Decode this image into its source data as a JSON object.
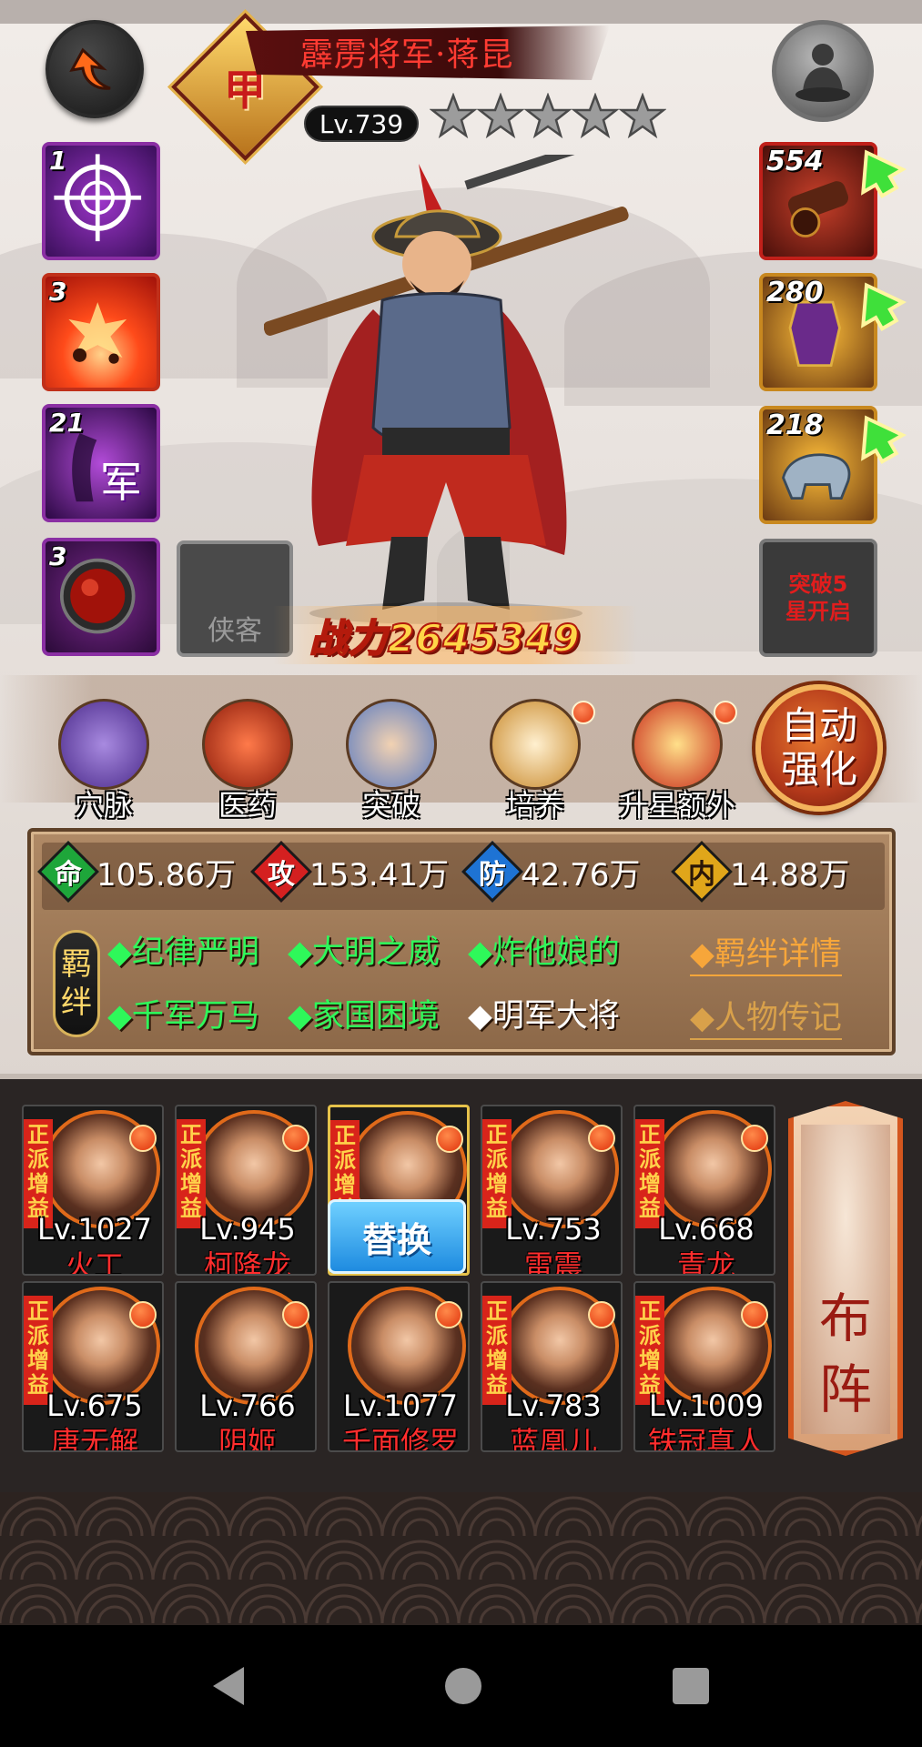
{
  "hero": {
    "name": "霹雳将军·蒋昆",
    "level": "Lv.739",
    "rank_char": "甲",
    "stars": 5,
    "power": "战力2645349"
  },
  "skills": [
    {
      "count": "1",
      "icon": "crosshair-icon"
    },
    {
      "count": "3",
      "icon": "explosion-icon"
    },
    {
      "count": "21",
      "icon": "army-icon",
      "label": "军"
    },
    {
      "count": "3",
      "icon": "red-orb-icon"
    }
  ],
  "companion_slot": {
    "label": "侠客"
  },
  "equipment": [
    {
      "count": "554",
      "icon": "cannon-icon"
    },
    {
      "count": "280",
      "icon": "urn-icon"
    },
    {
      "count": "218",
      "icon": "tiger-icon"
    }
  ],
  "breakthrough_slot": {
    "line1": "突破5",
    "line2": "星开启"
  },
  "functions": [
    {
      "label": "穴脉",
      "icon": "meridian-icon",
      "dot": false
    },
    {
      "label": "医药",
      "icon": "medicine-icon",
      "dot": false
    },
    {
      "label": "突破",
      "icon": "breakthrough-icon",
      "dot": false
    },
    {
      "label": "培养",
      "icon": "scroll-icon",
      "dot": true
    },
    {
      "label": "升星额外",
      "icon": "star-upgrade-icon",
      "dot": true
    }
  ],
  "auto_strengthen": {
    "line1": "自动",
    "line2": "强化"
  },
  "stats": {
    "life": {
      "glyph": "命",
      "value": "105.86万"
    },
    "attack": {
      "glyph": "攻",
      "value": "153.41万"
    },
    "defense": {
      "glyph": "防",
      "value": "42.76万"
    },
    "inner": {
      "glyph": "内",
      "value": "14.88万"
    }
  },
  "bonds": {
    "tag": [
      "羁",
      "绊"
    ],
    "row1": [
      "◆纪律严明",
      "◆大明之威",
      "◆炸他娘的"
    ],
    "row2": [
      "◆千军万马",
      "◆家国困境",
      "◆明军大将"
    ],
    "detail_link": "◆羁绊详情",
    "bio_link": "◆人物传记"
  },
  "team": [
    {
      "level": "Lv.1027",
      "name": "火工",
      "tag": "正派增益"
    },
    {
      "level": "Lv.945",
      "name": "柯降龙",
      "tag": "正派增益"
    },
    {
      "level": "",
      "name": "",
      "tag": "正派增益",
      "current": true
    },
    {
      "level": "Lv.753",
      "name": "雷震",
      "tag": "正派增益"
    },
    {
      "level": "Lv.668",
      "name": "青龙",
      "tag": "正派增益"
    },
    {
      "level": "Lv.675",
      "name": "唐无解",
      "tag": "正派增益"
    },
    {
      "level": "Lv.766",
      "name": "阴姬",
      "tag": ""
    },
    {
      "level": "Lv.1077",
      "name": "千面修罗",
      "tag": ""
    },
    {
      "level": "Lv.783",
      "name": "蓝凰儿",
      "tag": "正派增益"
    },
    {
      "level": "Lv.1009",
      "name": "铁冠真人",
      "tag": "正派增益"
    }
  ],
  "replace_button": "替换",
  "formation_button": "布阵",
  "colors": {
    "bond_active": "#2ef85a",
    "bond_link": "#f7a63a",
    "name_red": "#ff3b32",
    "power_gold": "#ffd648"
  }
}
